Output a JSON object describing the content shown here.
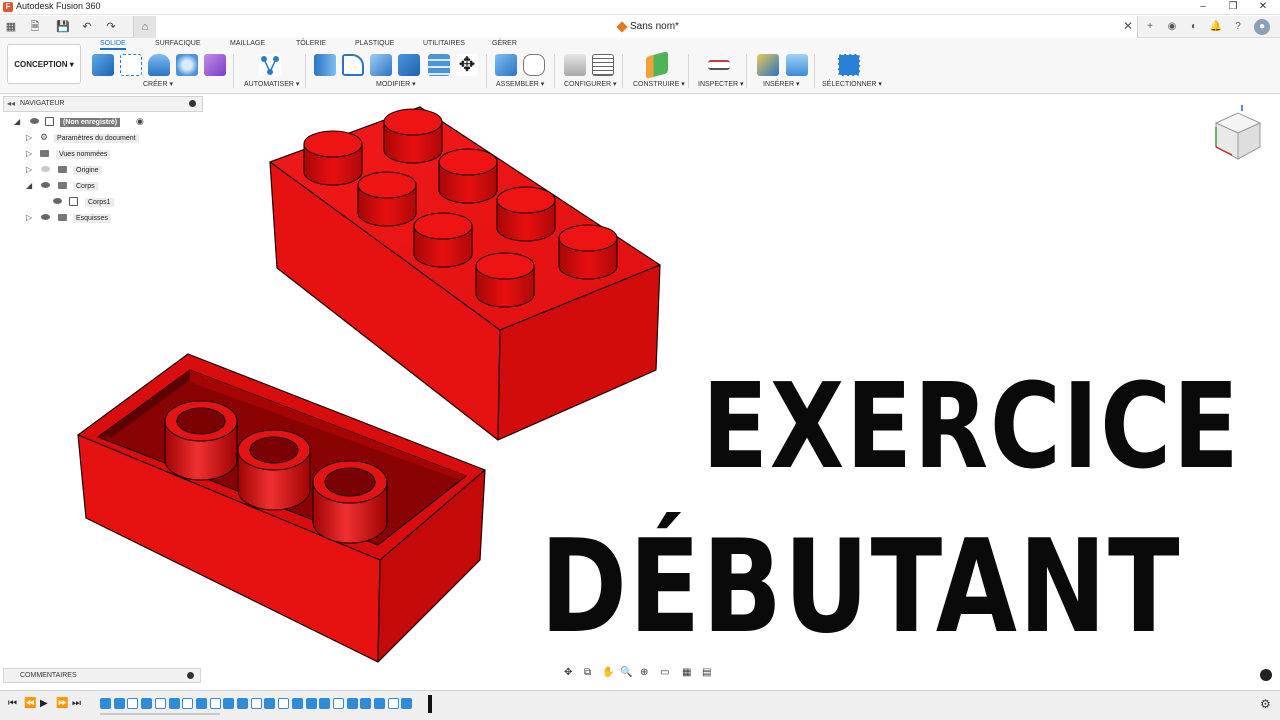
{
  "window": {
    "app_title": "Autodesk Fusion 360",
    "document_name": "Sans nom*"
  },
  "ribbon": {
    "workspace": "CONCEPTION ▾",
    "tabs": [
      "SOLIDE",
      "SURFACIQUE",
      "MAILLAGE",
      "TÔLERIE",
      "PLASTIQUE",
      "UTILITAIRES",
      "GÉRER"
    ],
    "active_tab": "SOLIDE",
    "groups": [
      "CRÉER ▾",
      "AUTOMATISER ▾",
      "MODIFIER ▾",
      "ASSEMBLER ▾",
      "CONFIGURER ▾",
      "CONSTRUIRE ▾",
      "INSPECTER ▾",
      "INSÉRER ▾",
      "SÉLECTIONNER ▾"
    ]
  },
  "navigator": {
    "title": "NAVIGATEUR",
    "root": "(Non enregistré)",
    "items": [
      {
        "label": "Paramètres du document"
      },
      {
        "label": "Vues nommées"
      },
      {
        "label": "Origine"
      },
      {
        "label": "Corps"
      },
      {
        "label": "Corps1"
      },
      {
        "label": "Esquisses"
      }
    ]
  },
  "comments": {
    "title": "COMMENTAIRES"
  },
  "overlay": {
    "line1": "EXERCICE",
    "line2": "DÉBUTANT"
  },
  "colors": {
    "brick_red": "#e81010",
    "brick_dark": "#b00808",
    "accent_blue": "#1a72c9",
    "timeline_blue": "#2f8ad8"
  }
}
